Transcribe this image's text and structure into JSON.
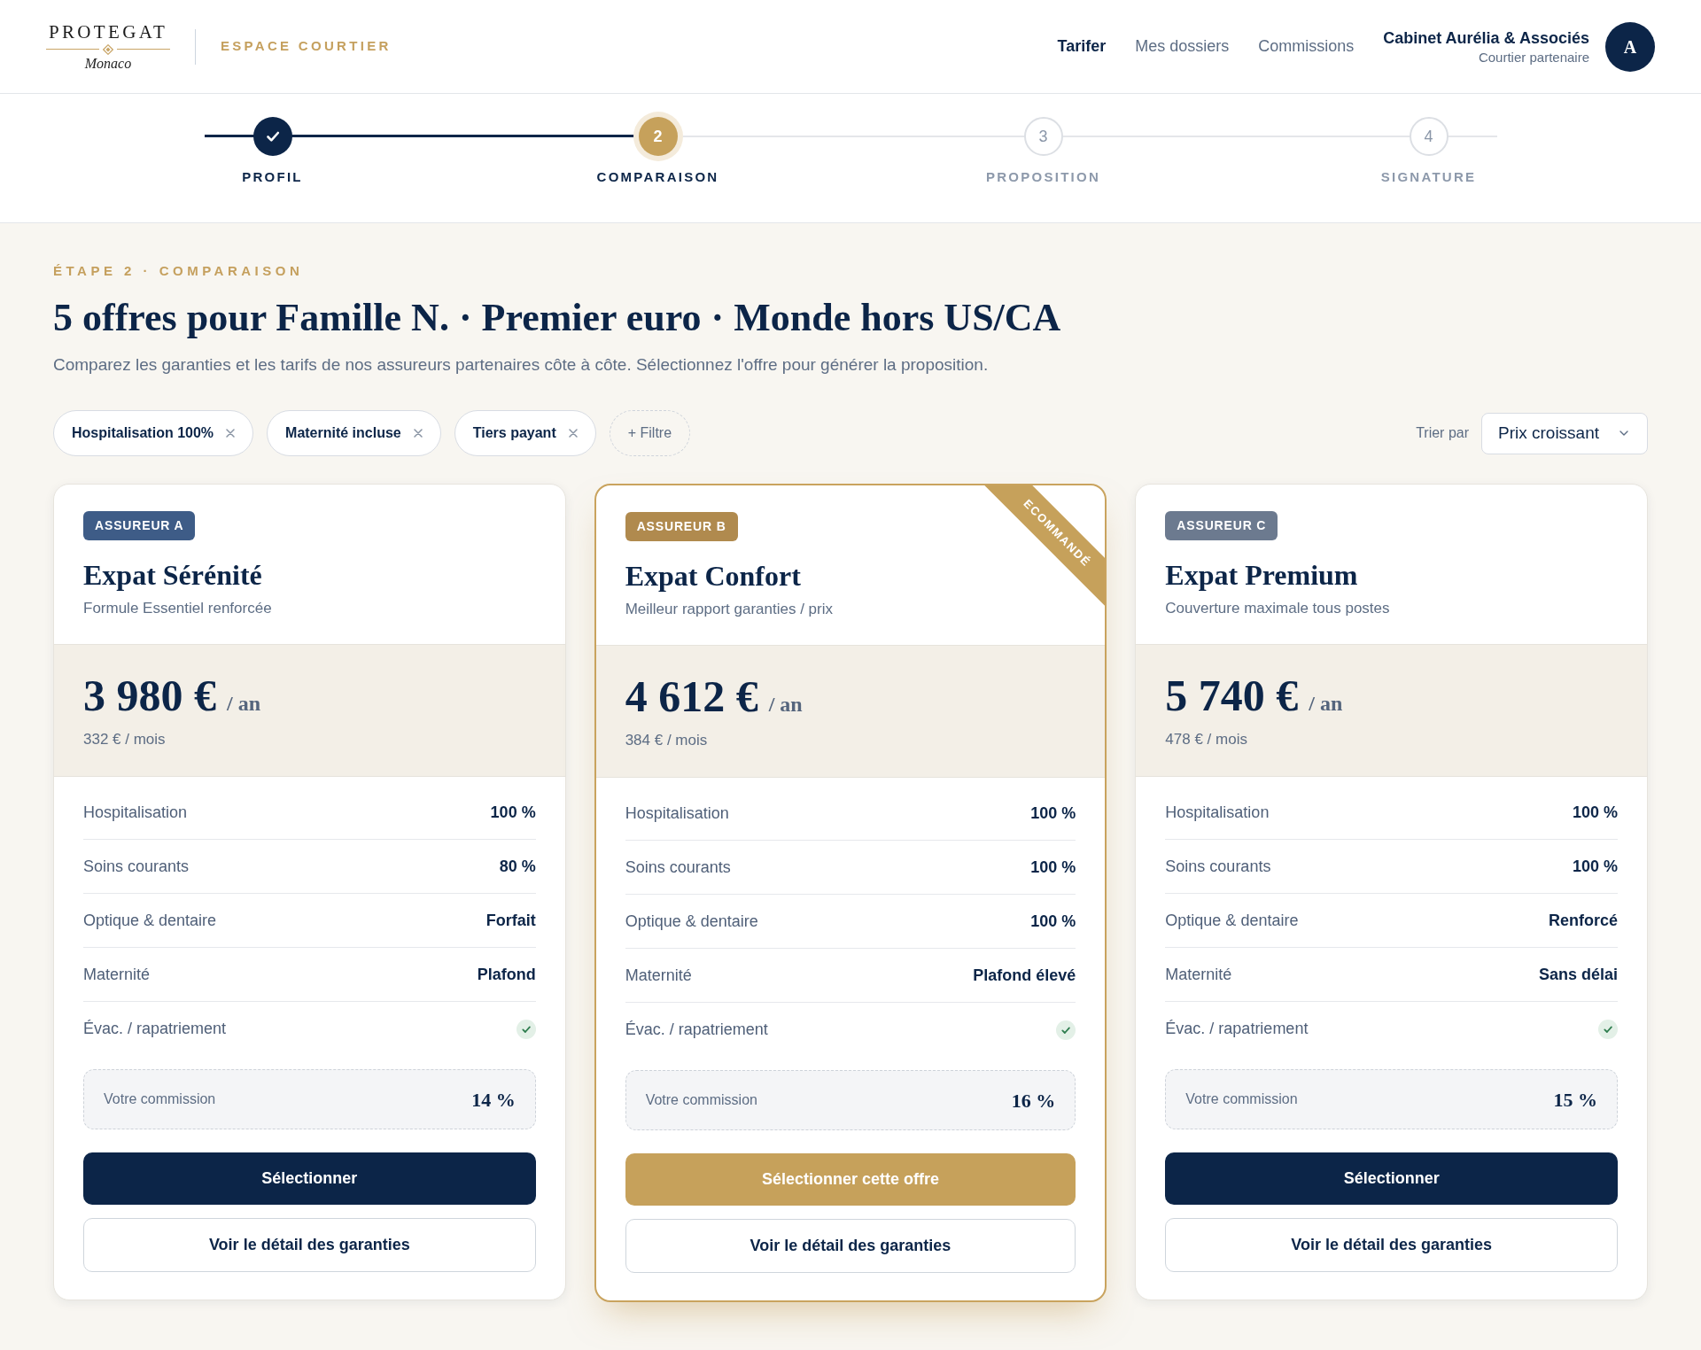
{
  "header": {
    "logo": {
      "wordmark": "PROTEGAT",
      "place": "Monaco"
    },
    "portal": "ESPACE COURTIER",
    "nav": [
      {
        "label": "Tarifer",
        "selected": true
      },
      {
        "label": "Mes dossiers",
        "selected": false
      },
      {
        "label": "Commissions",
        "selected": false
      }
    ],
    "account": {
      "name": "Cabinet Aurélia & Associés",
      "role": "Courtier partenaire",
      "initial": "A"
    }
  },
  "stepper": [
    {
      "label": "PROFIL",
      "done": true,
      "selected": false
    },
    {
      "number": "2",
      "label": "COMPARAISON",
      "done": false,
      "selected": true
    },
    {
      "number": "3",
      "label": "PROPOSITION",
      "done": false,
      "selected": false
    },
    {
      "number": "4",
      "label": "SIGNATURE",
      "done": false,
      "selected": false
    }
  ],
  "intro": {
    "eyebrow": "ÉTAPE 2 · COMPARAISON",
    "title": "5 offres pour Famille N. · Premier euro · Monde hors US/CA",
    "subtitle": "Comparez les garanties et les tarifs de nos assureurs partenaires côte à côte. Sélectionnez l'offre pour générer la proposition."
  },
  "filters": [
    {
      "kind": "chip",
      "label": "Hospitalisation 100%"
    },
    {
      "kind": "chip",
      "label": "Maternité incluse"
    },
    {
      "kind": "chip",
      "label": "Tiers payant"
    },
    {
      "kind": "add",
      "label": "+ Filtre"
    }
  ],
  "sort": {
    "label": "Trier par",
    "value": "Prix croissant"
  },
  "offers": [
    {
      "badge": {
        "label": "ASSUREUR A",
        "color": "#3e5c87"
      },
      "name": "Expat Sérénité",
      "tagline": "Formule Essentiel renforcée",
      "price": "3 980 €",
      "period": "/ an",
      "monthly": "332 € / mois",
      "coverage": [
        {
          "kind": "value",
          "label": "Hospitalisation",
          "value": "100 %"
        },
        {
          "kind": "value",
          "label": "Soins courants",
          "value": "80 %"
        },
        {
          "kind": "value",
          "label": "Optique & dentaire",
          "value": "Forfait"
        },
        {
          "kind": "value",
          "label": "Maternité",
          "value": "Plafond"
        },
        {
          "kind": "check",
          "label": "Évac. / rapatriement",
          "included": true
        }
      ],
      "commission_label": "Votre commission",
      "commission": "14 %",
      "recommended": false,
      "primary_action": "Sélectionner",
      "secondary_action": "Voir le détail des garanties"
    },
    {
      "badge": {
        "label": "ASSUREUR B",
        "color": "#b08a4e"
      },
      "ribbon": "ECOMMANDÉ",
      "name": "Expat Confort",
      "tagline": "Meilleur rapport garanties / prix",
      "price": "4 612 €",
      "period": "/ an",
      "monthly": "384 € / mois",
      "coverage": [
        {
          "kind": "value",
          "label": "Hospitalisation",
          "value": "100 %"
        },
        {
          "kind": "value",
          "label": "Soins courants",
          "value": "100 %"
        },
        {
          "kind": "value",
          "label": "Optique & dentaire",
          "value": "100 %"
        },
        {
          "kind": "value",
          "label": "Maternité",
          "value": "Plafond élevé"
        },
        {
          "kind": "check",
          "label": "Évac. / rapatriement",
          "included": true
        }
      ],
      "commission_label": "Votre commission",
      "commission": "16 %",
      "recommended": true,
      "primary_action": "Sélectionner cette offre",
      "secondary_action": "Voir le détail des garanties"
    },
    {
      "badge": {
        "label": "ASSUREUR C",
        "color": "#6c7a8f"
      },
      "name": "Expat Premium",
      "tagline": "Couverture maximale tous postes",
      "price": "5 740 €",
      "period": "/ an",
      "monthly": "478 € / mois",
      "coverage": [
        {
          "kind": "value",
          "label": "Hospitalisation",
          "value": "100 %"
        },
        {
          "kind": "value",
          "label": "Soins courants",
          "value": "100 %"
        },
        {
          "kind": "value",
          "label": "Optique & dentaire",
          "value": "Renforcé"
        },
        {
          "kind": "value",
          "label": "Maternité",
          "value": "Sans délai"
        },
        {
          "kind": "check",
          "label": "Évac. / rapatriement",
          "included": true
        }
      ],
      "commission_label": "Votre commission",
      "commission": "15 %",
      "recommended": false,
      "primary_action": "Sélectionner",
      "secondary_action": "Voir le détail des garanties"
    }
  ]
}
